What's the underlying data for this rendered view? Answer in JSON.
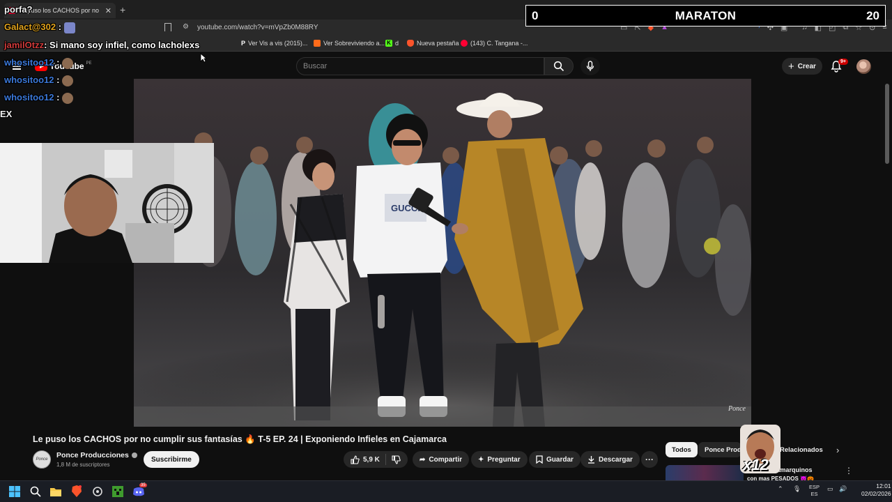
{
  "browser": {
    "tab_title": "Le puso los CACHOS por no",
    "url": "youtube.com/watch?v=mVpZb0M88RY",
    "bookmarks": [
      {
        "label": "Ver Vis a vis (2015)...",
        "icon": "p-icon",
        "color": "#ffffff"
      },
      {
        "label": "Ver Sobreviviendo a...",
        "icon": "orange-square-icon",
        "color": "#ff6b1a"
      },
      {
        "label": "d",
        "icon": "kick-icon",
        "color": "#53fc18"
      },
      {
        "label": "Nueva pestaña",
        "icon": "brave-icon",
        "color": "#fb542b"
      },
      {
        "label": "(143) C. Tangana -...",
        "icon": "youtube-icon",
        "color": "#ff0033"
      }
    ]
  },
  "youtube": {
    "logo_text": "YouTube",
    "region": "PE",
    "search_placeholder": "Buscar",
    "create_label": "Crear",
    "notif_count": "9+"
  },
  "video": {
    "title": "Le puso los CACHOS por no cumplir sus fantasías 🔥 T-5 EP. 24 | Exponiendo Infieles en Cajamarca",
    "channel": "Ponce Producciones",
    "subscribers": "1,8 M de suscriptores",
    "subscribe_label": "Suscribirme",
    "likes": "5,9 K",
    "actions": {
      "share": "Compartir",
      "ask": "Preguntar",
      "save": "Guardar",
      "download": "Descargar"
    },
    "watermark": "Ponce",
    "shirt_text": "GUCCI"
  },
  "chips": [
    "Todos",
    "Ponce Produ",
    "Relacionados"
  ],
  "recommendation": {
    "title": "RNOS Cajamarquinos",
    "sub": "con mas PESADOS 😈🎃"
  },
  "stream_overlay": {
    "chat": [
      {
        "user": "porfa?",
        "color": "#ffffff",
        "message": ""
      },
      {
        "user": "Galact@302",
        "color": "#e0a21c",
        "message": ":"
      },
      {
        "user": "jamilOtzz",
        "color": "#d23b3b",
        "message": ": Si mano soy infiel, como lacholexs"
      },
      {
        "user": "whositoo12",
        "color": "#3b78d8",
        "message": ":"
      },
      {
        "user": "whositoo12",
        "color": "#3b78d8",
        "message": ":"
      },
      {
        "user": "whositoo12",
        "color": "#3b78d8",
        "message": ":"
      },
      {
        "user": "EX",
        "color": "#ffffff",
        "message": ""
      }
    ],
    "marathon": {
      "left": "0",
      "title": "MARATON",
      "right": "20"
    },
    "sticker_text": "x12"
  },
  "taskbar": {
    "lang_top": "ESP",
    "lang_bottom": "ES",
    "time": "12:01",
    "date": "02/02/2026",
    "discord_badge": "35"
  }
}
